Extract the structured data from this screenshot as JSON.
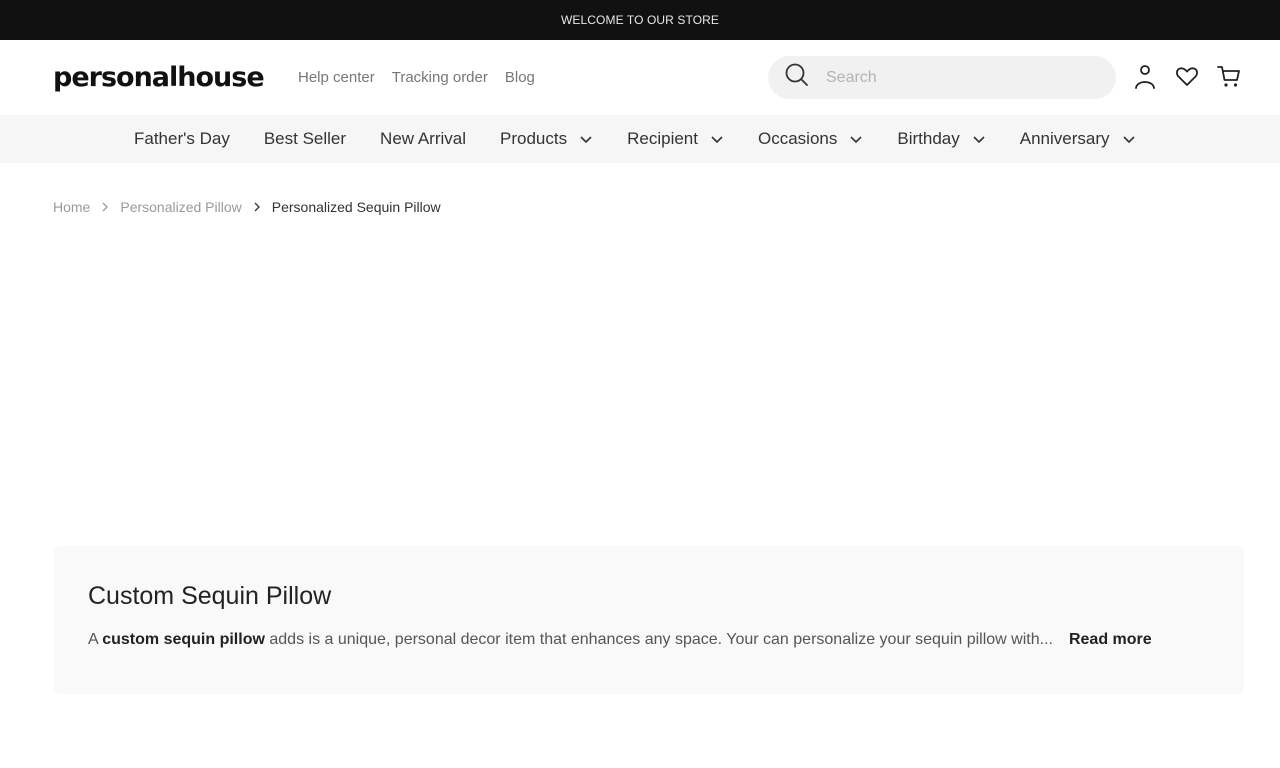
{
  "topbar": {
    "text": "WELCOME TO OUR STORE"
  },
  "header": {
    "logo": "personalhouse",
    "links": [
      "Help center",
      "Tracking order",
      "Blog"
    ],
    "search_placeholder": "Search",
    "icons": [
      "user-icon",
      "heart-icon",
      "cart-icon"
    ]
  },
  "nav": {
    "items": [
      {
        "label": "Father's Day",
        "dropdown": false
      },
      {
        "label": "Best Seller",
        "dropdown": false
      },
      {
        "label": "New Arrival",
        "dropdown": false
      },
      {
        "label": "Products",
        "dropdown": true
      },
      {
        "label": "Recipient",
        "dropdown": true
      },
      {
        "label": "Occasions",
        "dropdown": true
      },
      {
        "label": "Birthday",
        "dropdown": true
      },
      {
        "label": "Anniversary",
        "dropdown": true
      }
    ]
  },
  "breadcrumb": {
    "home": "Home",
    "parent": "Personalized Pillow",
    "current": "Personalized Sequin Pillow"
  },
  "description": {
    "title": "Custom Sequin Pillow",
    "prefix": "A ",
    "bold": "custom sequin pillow",
    "rest": " adds is a unique, personal decor item that enhances any space. Your can personalize your sequin pillow with...",
    "read_more": "Read more"
  }
}
